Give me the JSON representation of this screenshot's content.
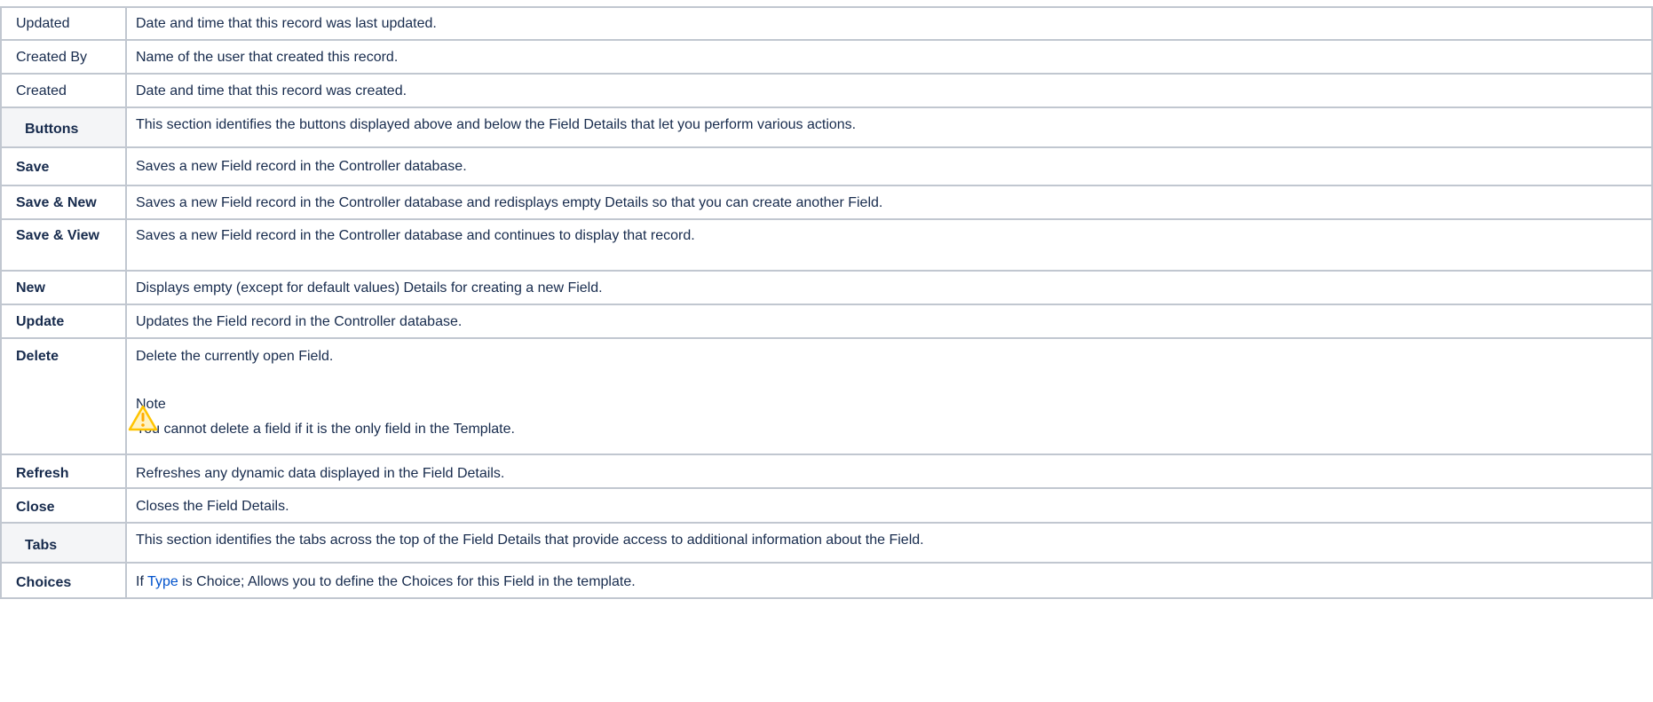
{
  "rows": [
    {
      "kind": "field",
      "label": "Updated",
      "desc": "Date and time that this record was last updated."
    },
    {
      "kind": "field",
      "label": "Created By",
      "desc": "Name of the user that created this record."
    },
    {
      "kind": "field",
      "label": "Created",
      "desc": "Date and time that this record was created."
    },
    {
      "kind": "section",
      "label": "Buttons",
      "desc": "This section identifies the buttons displayed above and below the Field Details that let you perform various actions."
    },
    {
      "kind": "button",
      "label": "Save",
      "desc": "Saves a new Field record in the Controller database."
    },
    {
      "kind": "button",
      "label": "Save & New",
      "desc": "Saves a new Field record in the Controller database and redisplays empty Details so that you can create another Field."
    },
    {
      "kind": "button",
      "label": "Save & View",
      "desc": "Saves a new Field record in the Controller database and continues to display that record."
    },
    {
      "kind": "button",
      "label": "New",
      "desc": "Displays empty (except for default values) Details for creating a new Field."
    },
    {
      "kind": "button",
      "label": "Update",
      "desc": "Updates the Field record in the Controller database."
    },
    {
      "kind": "button",
      "label": "Delete",
      "desc": "Delete the currently open Field.",
      "note_title": "Note",
      "note_text": "You cannot delete a field if it is the only field in the Template."
    },
    {
      "kind": "button",
      "label": "Refresh",
      "desc": "Refreshes any dynamic data displayed in the Field Details."
    },
    {
      "kind": "button",
      "label": "Close",
      "desc": "Closes the Field Details."
    },
    {
      "kind": "section",
      "label": "Tabs",
      "desc": "This section identifies the tabs across the top of the Field Details that provide access to additional information about the Field."
    },
    {
      "kind": "button",
      "label": "Choices",
      "desc_prefix": "If ",
      "link": "Type",
      "desc_suffix": " is Choice; Allows you to define the Choices for this Field in the template."
    }
  ],
  "colors": {
    "border": "#c1c7d0",
    "section_bg": "#f4f5f7",
    "link": "#0052cc",
    "warning": "#ffc400"
  },
  "icons": {
    "note": "warning-icon"
  }
}
